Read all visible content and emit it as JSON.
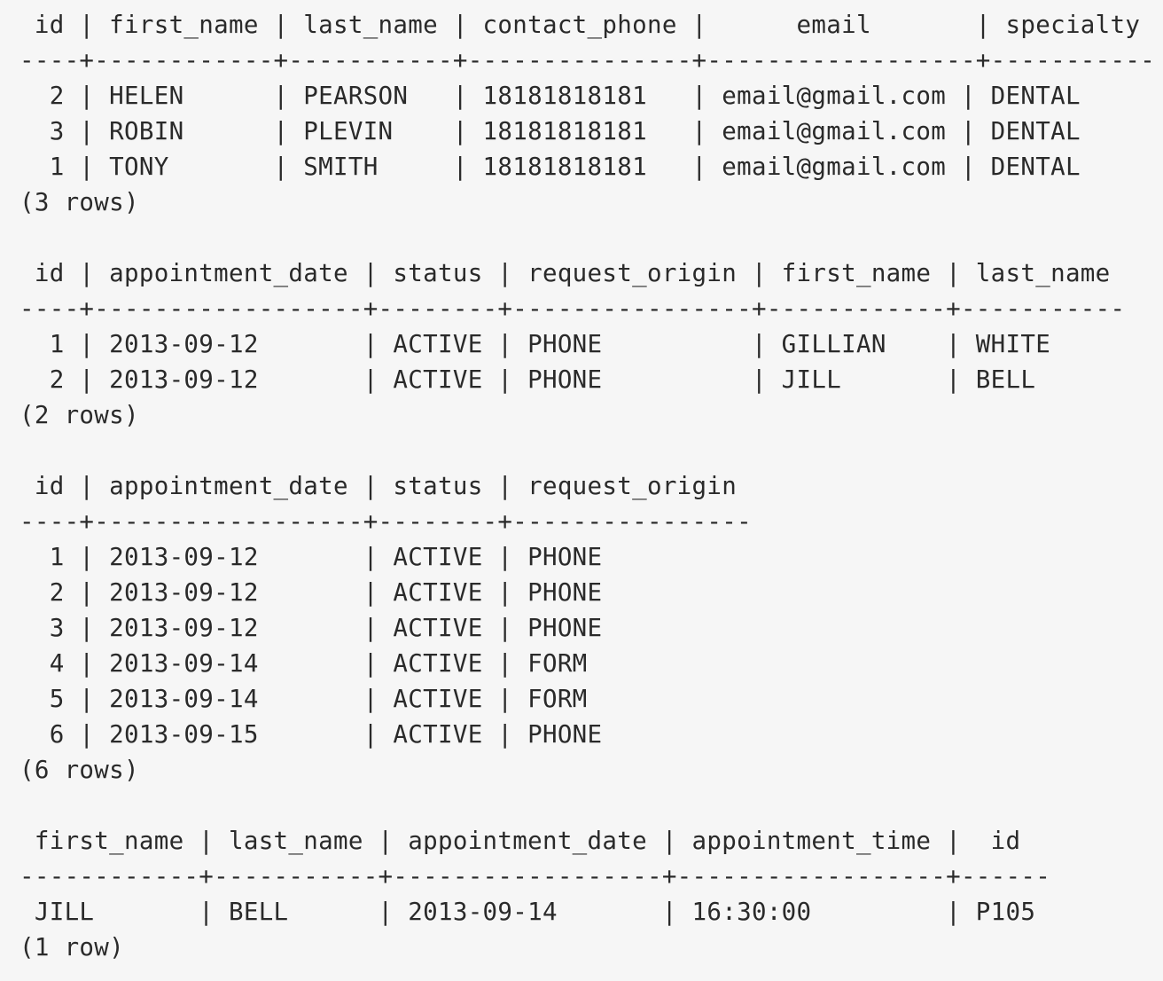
{
  "output": {
    "lines": [
      " id | first_name | last_name | contact_phone |      email       | specialty",
      "----+------------+-----------+---------------+------------------+-----------",
      "  2 | HELEN      | PEARSON   | 18181818181   | email@gmail.com | DENTAL",
      "  3 | ROBIN      | PLEVIN    | 18181818181   | email@gmail.com | DENTAL",
      "  1 | TONY       | SMITH     | 18181818181   | email@gmail.com | DENTAL",
      "(3 rows)",
      " id | appointment_date | status | request_origin | first_name | last_name",
      "----+------------------+--------+----------------+------------+-----------",
      "  1 | 2013-09-12       | ACTIVE | PHONE          | GILLIAN    | WHITE",
      "  2 | 2013-09-12       | ACTIVE | PHONE          | JILL       | BELL",
      "(2 rows)",
      " id | appointment_date | status | request_origin",
      "----+------------------+--------+----------------",
      "  1 | 2013-09-12       | ACTIVE | PHONE",
      "  2 | 2013-09-12       | ACTIVE | PHONE",
      "  3 | 2013-09-12       | ACTIVE | PHONE",
      "  4 | 2013-09-14       | ACTIVE | FORM",
      "  5 | 2013-09-14       | ACTIVE | FORM",
      "  6 | 2013-09-15       | ACTIVE | PHONE",
      "(6 rows)",
      " first_name | last_name | appointment_date | appointment_time |  id",
      "------------+-----------+------------------+------------------+------",
      " JILL       | BELL      | 2013-09-14       | 16:30:00         | P105",
      "(1 row)"
    ]
  }
}
